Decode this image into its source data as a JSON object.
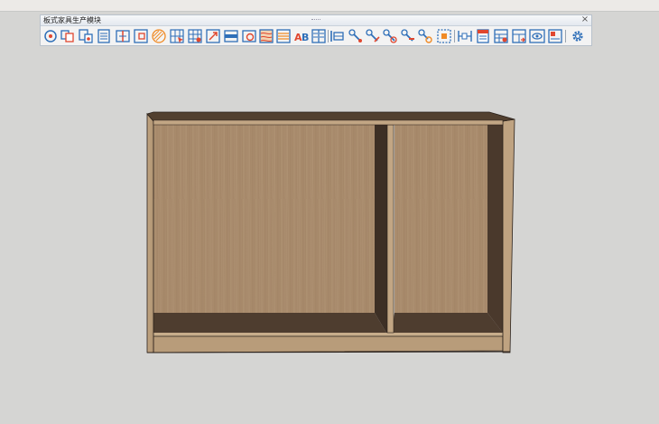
{
  "toolbar": {
    "title": "板式家具生产模块",
    "close_glyph": "×",
    "colors": {
      "icon_blue": "#2f6fb8",
      "icon_red": "#e0472f",
      "icon_orange": "#f08a24"
    },
    "buttons": [
      "target-cabinet-icon",
      "copy-panels-icon",
      "panel-stack-icon",
      "list-icon",
      "split-panel-icon",
      "panel-edit-icon",
      "hatch-panel-icon",
      "grid-select-icon",
      "grid-edit-icon",
      "resize-arrow-icon",
      "edge-band-icon",
      "panel-rotate-icon",
      "texture-panel-icon",
      "material-panel-icon",
      "text-ab-icon",
      "columns-panel-icon",
      "hardware-insert-icon",
      "drill-tool-icon",
      "drill-edit-icon",
      "drill-rotate-icon",
      "drill-delete-icon",
      "drill-search-icon",
      "boundary-icon",
      "dimension-icon",
      "label-calendar-icon",
      "report-grid-icon",
      "export-grid-icon",
      "view-eye-icon",
      "output-panel-icon",
      "settings-gear-icon"
    ]
  },
  "scene": {
    "background": "#d5d5d3",
    "wood_light": "#b49a79",
    "wood_back": "#a88c6b",
    "wood_dark": "#4d3b2e",
    "edge": "#2a211b"
  }
}
